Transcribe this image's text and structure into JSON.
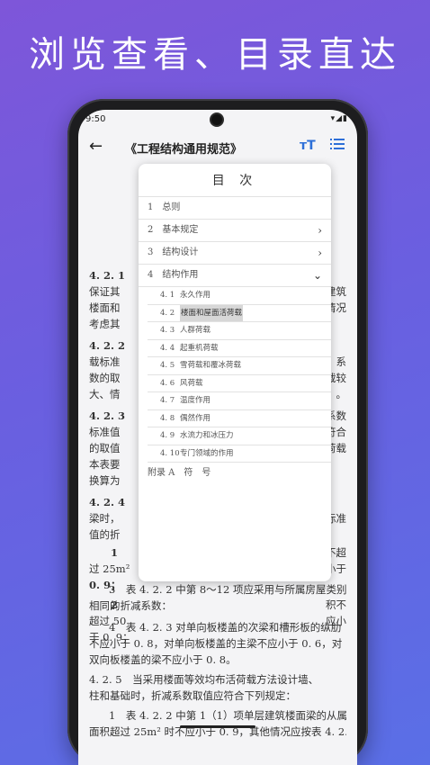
{
  "banner": {
    "text": "浏览查看、目录直达"
  },
  "status": {
    "time": "9:50",
    "icons": "▾◢▮"
  },
  "appbar": {
    "back": "←",
    "title": "《工程结构通用规范》",
    "font_btn": "тT"
  },
  "doc": {
    "lines": [
      {
        "a": "4. 2. 1",
        "b": ""
      },
      {
        "a": "保证其",
        "b": "建筑"
      },
      {
        "a": "楼面和",
        "b": "情况"
      },
      {
        "a": "考虑其",
        "b": ""
      },
      {
        "a": "4. 2. 2",
        "b": ""
      },
      {
        "a": "载标准",
        "b": "系"
      },
      {
        "a": "数的取",
        "b": "载较"
      },
      {
        "a": "大、情",
        "b": "。"
      },
      {
        "a": "4. 2. 3",
        "b": "系数"
      },
      {
        "a": "标准值",
        "b": "不符合"
      },
      {
        "a": "的取值",
        "b": "荷载"
      },
      {
        "a": "本表要",
        "b": ""
      },
      {
        "a": "换算为",
        "b": ""
      },
      {
        "a": "4. 2. 4",
        "b": ""
      },
      {
        "a": "梁时，",
        "b": "标准"
      },
      {
        "a": "值的折",
        "b": ""
      },
      {
        "a": "1",
        "b": "不超"
      },
      {
        "a": "过 25m²",
        "b": "小于"
      },
      {
        "a": "0. 9；",
        "b": ""
      },
      {
        "a": "2",
        "b": "积不"
      },
      {
        "a": "超过 50",
        "b": "应小"
      },
      {
        "a": "于 0. 9；",
        "b": ""
      }
    ],
    "full_lines": [
      "3　表 4. 2. 2 中第 8～12 项应采用与所属房屋类别",
      "相同的折减系数：",
      "4　表 4. 2. 3 对单向板楼盖的次梁和槽形板的纵肋",
      "不应小于 0. 8，对单向板楼盖的主梁不应小于 0. 6，对",
      "双向板楼盖的梁不应小于 0. 8。",
      "4. 2. 5　当采用楼面等效均布活荷载方法设计墙、",
      "柱和基础时，折减系数取值应符合下列规定：",
      "1　表 4. 2. 2 中第 1（1）项单层建筑楼面梁的从属",
      "面积超过 25m² 时不应小于 0. 9，其他情况应按表 4. 2. 5"
    ]
  },
  "toc": {
    "title": "目 次",
    "items": [
      {
        "label": "1　总则",
        "chev": ""
      },
      {
        "label": "2　基本规定",
        "chev": "›"
      },
      {
        "label": "3　结构设计",
        "chev": "›"
      },
      {
        "label": "4　结构作用",
        "chev": "⌄"
      }
    ],
    "subitems": [
      {
        "num": "4. 1",
        "label": "永久作用"
      },
      {
        "num": "4. 2",
        "label": "楼面和屋面活荷载"
      },
      {
        "num": "4. 3",
        "label": "人群荷载"
      },
      {
        "num": "4. 4",
        "label": "起重机荷载"
      },
      {
        "num": "4. 5",
        "label": "雪荷载和覆冰荷载"
      },
      {
        "num": "4. 6",
        "label": "风荷载"
      },
      {
        "num": "4. 7",
        "label": "温度作用"
      },
      {
        "num": "4. 8",
        "label": "偶然作用"
      },
      {
        "num": "4. 9",
        "label": "水流力和冰压力"
      },
      {
        "num": "4. 10",
        "label": "专门领域的作用"
      }
    ],
    "appendix": "附录 A　符　号"
  },
  "colors": {
    "accent": "#2d6fd8",
    "highlight": "#d7d7d7"
  }
}
